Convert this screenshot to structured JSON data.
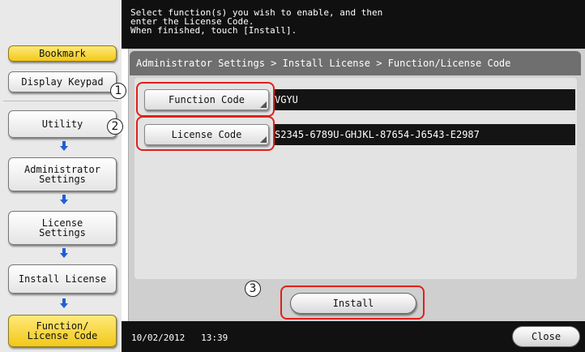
{
  "sidebar": {
    "bookmark_label": "Bookmark",
    "display_keypad_label": "Display Keypad",
    "steps": [
      "Utility",
      "Administrator\nSettings",
      "License\nSettings",
      "Install License",
      "Function/\nLicense Code"
    ]
  },
  "header": {
    "message": "Select function(s) you wish to enable, and then\nenter the License Code.\nWhen finished, touch [Install]."
  },
  "breadcrumb": "Administrator Settings > Install License > Function/License Code",
  "fields": {
    "function_code": {
      "label": "Function Code",
      "value": "VGYU"
    },
    "license_code": {
      "label": "License Code",
      "value": "S2345-6789U-GHJKL-87654-J6543-E2987"
    }
  },
  "callouts": [
    "1",
    "2",
    "3"
  ],
  "install_label": "Install",
  "status_bar": {
    "date": "10/02/2012",
    "time": "13:39",
    "close_label": "Close"
  },
  "colors": {
    "highlight_yellow": "#f2c818",
    "step_arrow_blue": "#1f5fd6",
    "callout_red": "#e0201a"
  },
  "icons": {
    "step_arrow": "arrow-down-icon"
  }
}
